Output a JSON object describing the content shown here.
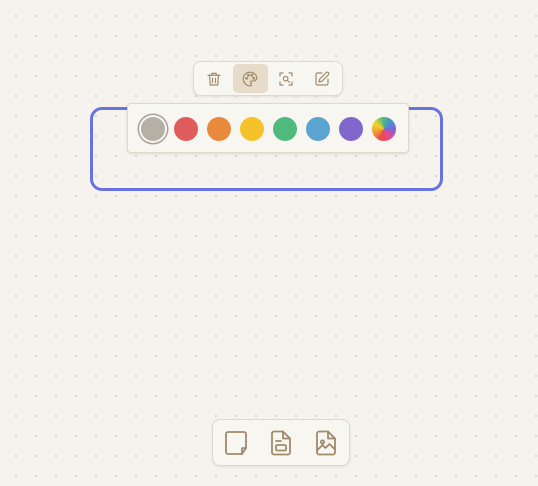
{
  "canvas": {
    "background": "#f6f3ee",
    "dot_color": "#d9d2c6"
  },
  "selected_node": {
    "border_color": "#6873e0"
  },
  "node_toolbar": {
    "buttons": [
      {
        "icon": "trash-icon",
        "active": false
      },
      {
        "icon": "palette-icon",
        "active": true
      },
      {
        "icon": "zoom-to-selection-icon",
        "active": false
      },
      {
        "icon": "edit-icon",
        "active": false
      }
    ],
    "icon_color": "#a08a6c",
    "active_bg": "#e7dcc9"
  },
  "color_palette": {
    "swatches": [
      {
        "name": "gray",
        "color": "#b5b0a6",
        "selected": true
      },
      {
        "name": "red",
        "color": "#e05c5c",
        "selected": false
      },
      {
        "name": "orange",
        "color": "#e8893c",
        "selected": false
      },
      {
        "name": "yellow",
        "color": "#f5c22a",
        "selected": false
      },
      {
        "name": "green",
        "color": "#4fba7b",
        "selected": false
      },
      {
        "name": "blue",
        "color": "#5ba3d1",
        "selected": false
      },
      {
        "name": "purple",
        "color": "#8167cc",
        "selected": false
      },
      {
        "name": "custom",
        "color": "conic-gradient",
        "selected": false
      }
    ]
  },
  "bottom_toolbar": {
    "buttons": [
      {
        "icon": "sticky-note-icon"
      },
      {
        "icon": "file-text-icon"
      },
      {
        "icon": "file-image-icon"
      }
    ],
    "icon_color": "#a08a6c"
  }
}
